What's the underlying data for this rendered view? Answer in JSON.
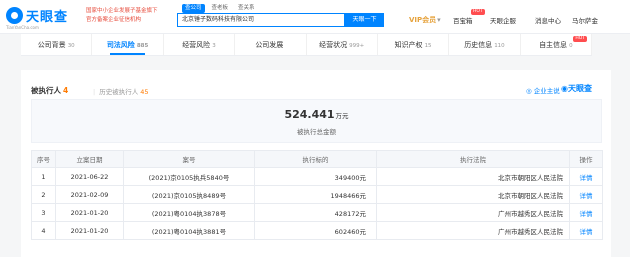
{
  "header": {
    "logo_text": "天眼查",
    "logo_sub": "TianYanCha.com",
    "banner_line1": "国家中小企业发展子基金旗下",
    "banner_line2": "官方备案企业征信机构",
    "search_tabs": [
      "查公司",
      "查老板",
      "查关系"
    ],
    "search_value": "北京锤子数码科技有限公司",
    "search_button": "天眼一下",
    "vip_label": "VIP会员",
    "nav": [
      "百宝箱",
      "天眼企服",
      "消息中心",
      "马尔萨金"
    ],
    "hot_badge": "HOT",
    "accent_color": "#0084ff"
  },
  "tabs": [
    {
      "label": "公司背景",
      "count": "30"
    },
    {
      "label": "司法风险",
      "count": "885"
    },
    {
      "label": "经营风险",
      "count": "3"
    },
    {
      "label": "公司发展",
      "count": ""
    },
    {
      "label": "经营状况",
      "count": "999+"
    },
    {
      "label": "知识产权",
      "count": "15"
    },
    {
      "label": "历史信息",
      "count": "110"
    },
    {
      "label": "自主信息",
      "count": "0"
    }
  ],
  "section": {
    "title": "被执行人",
    "count": "4",
    "history_label": "历史被执行人",
    "history_count": "45",
    "watch_label": "企业主说",
    "brand_mini": "天眼查",
    "total_value": "524.441",
    "total_unit": "万元",
    "total_label": "被执行总金额"
  },
  "table": {
    "headers": [
      "序号",
      "立案日期",
      "案号",
      "执行标的",
      "执行法院",
      "操作"
    ],
    "rows": [
      {
        "idx": "1",
        "date": "2021-06-22",
        "case": "(2021)京0105执兵5840号",
        "amount": "349400元",
        "court": "北京市朝阳区人民法院",
        "op": "详情"
      },
      {
        "idx": "2",
        "date": "2021-02-09",
        "case": "(2021)京0105执8489号",
        "amount": "1948466元",
        "court": "北京市朝阳区人民法院",
        "op": "详情"
      },
      {
        "idx": "3",
        "date": "2021-01-20",
        "case": "(2021)粤0104执3878号",
        "amount": "428172元",
        "court": "广州市越秀区人民法院",
        "op": "详情"
      },
      {
        "idx": "4",
        "date": "2021-01-20",
        "case": "(2021)粤0104执3881号",
        "amount": "602460元",
        "court": "广州市越秀区人民法院",
        "op": "详情"
      }
    ]
  }
}
